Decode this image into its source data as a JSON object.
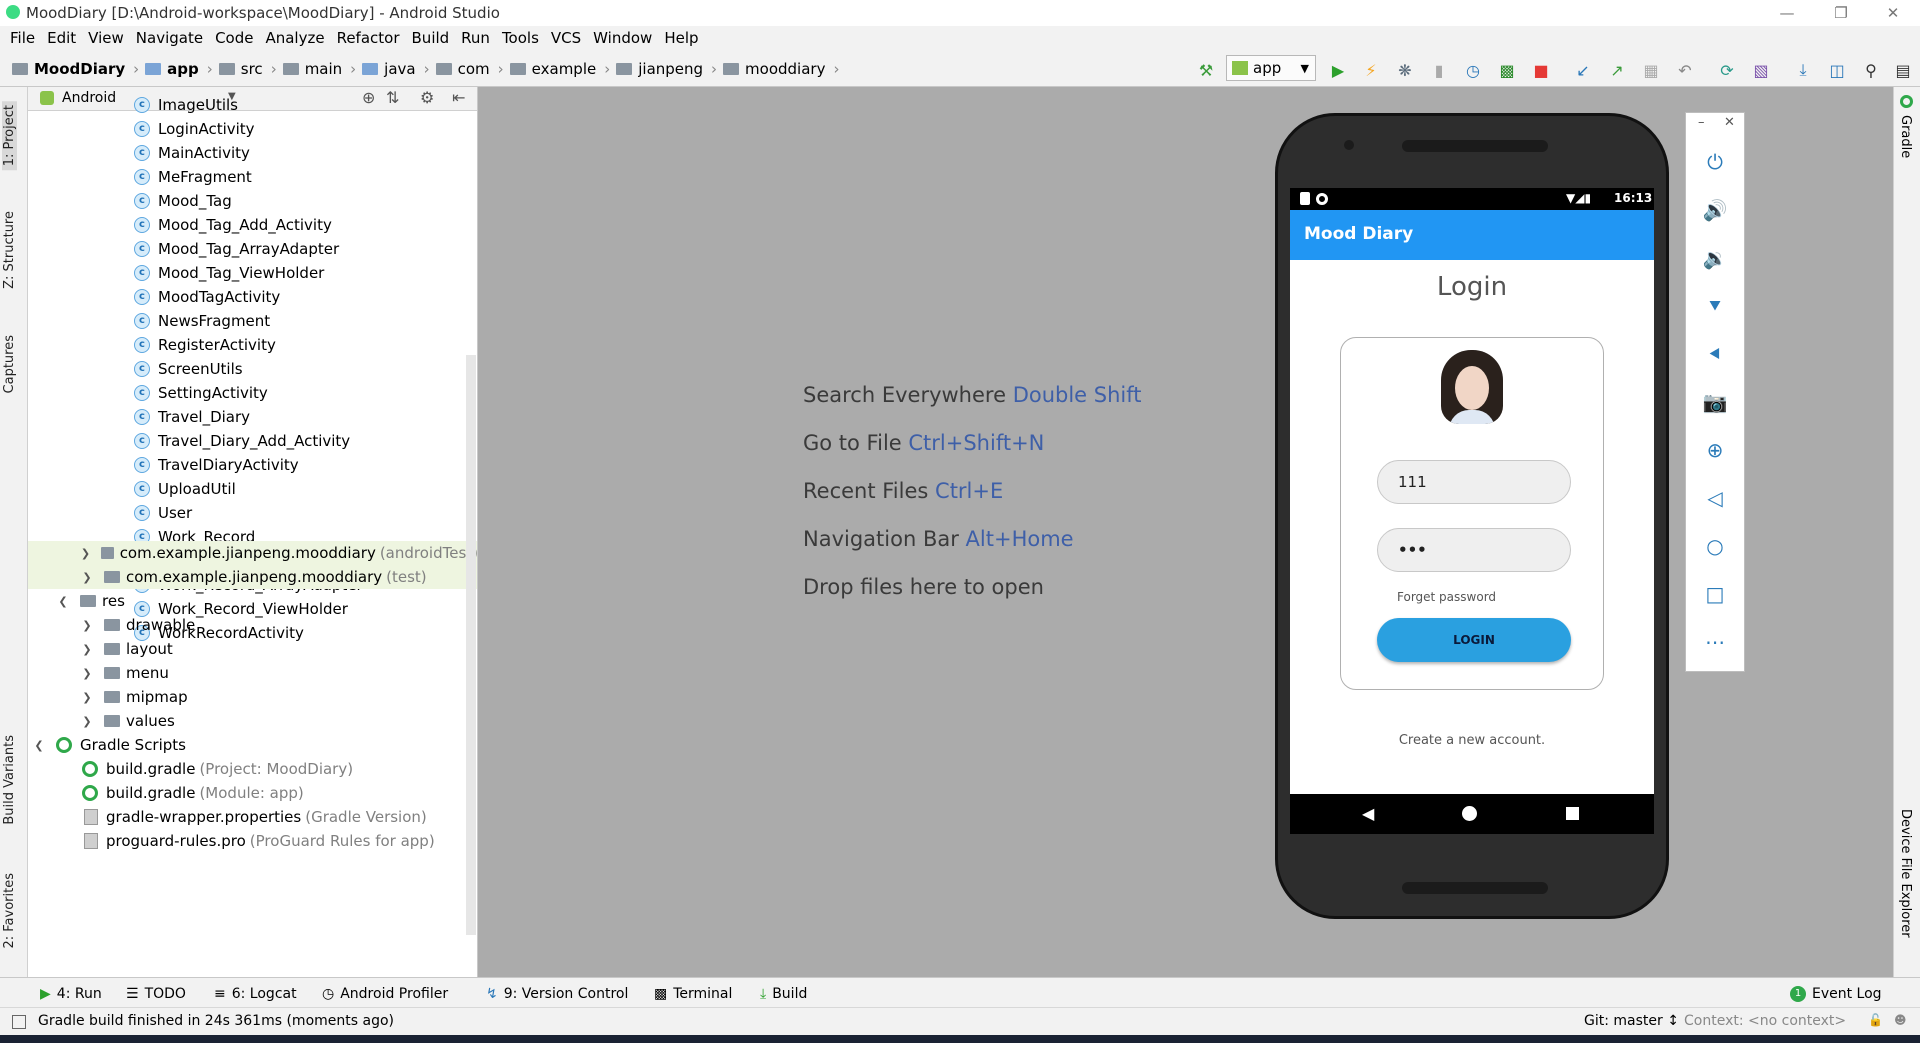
{
  "window": {
    "title": "MoodDiary [D:\\Android-workspace\\MoodDiary] - Android Studio"
  },
  "menu": [
    "File",
    "Edit",
    "View",
    "Navigate",
    "Code",
    "Analyze",
    "Refactor",
    "Build",
    "Run",
    "Tools",
    "VCS",
    "Window",
    "Help"
  ],
  "breadcrumb": [
    "MoodDiary",
    "app",
    "src",
    "main",
    "java",
    "com",
    "example",
    "jianpeng",
    "mooddiary"
  ],
  "run_config": "app",
  "project_panel": {
    "view_mode": "Android",
    "classes": [
      "ImageUtils",
      "LoginActivity",
      "MainActivity",
      "MeFragment",
      "Mood_Tag",
      "Mood_Tag_Add_Activity",
      "Mood_Tag_ArrayAdapter",
      "Mood_Tag_ViewHolder",
      "MoodTagActivity",
      "NewsFragment",
      "RegisterActivity",
      "ScreenUtils",
      "SettingActivity",
      "Travel_Diary",
      "Travel_Diary_Add_Activity",
      "TravelDiaryActivity",
      "UploadUtil",
      "User",
      "Work_Record",
      "Work_Record_Add_Activity",
      "Work_Record_ArrayAdapter",
      "Work_Record_ViewHolder",
      "WorkRecordActivity"
    ],
    "packages": [
      {
        "name": "com.example.jianpeng.mooddiary",
        "suffix": "(androidTest)"
      },
      {
        "name": "com.example.jianpeng.mooddiary",
        "suffix": "(test)"
      }
    ],
    "res_label": "res",
    "res_children": [
      "drawable",
      "layout",
      "menu",
      "mipmap",
      "values"
    ],
    "gradle_label": "Gradle Scripts",
    "gradle_files": [
      {
        "name": "build.gradle",
        "suffix": "(Project: MoodDiary)"
      },
      {
        "name": "build.gradle",
        "suffix": "(Module: app)"
      },
      {
        "name": "gradle-wrapper.properties",
        "suffix": "(Gradle Version)"
      },
      {
        "name": "proguard-rules.pro",
        "suffix": "(ProGuard Rules for app)"
      }
    ]
  },
  "left_tabs": [
    "1: Project",
    "Z: Structure",
    "Captures",
    "Build Variants",
    "2: Favorites"
  ],
  "right_tabs": [
    "Gradle",
    "Device File Explorer"
  ],
  "editor_hints": [
    {
      "text": "Search Everywhere",
      "key": "Double Shift"
    },
    {
      "text": "Go to File",
      "key": "Ctrl+Shift+N"
    },
    {
      "text": "Recent Files",
      "key": "Ctrl+E"
    },
    {
      "text": "Navigation Bar",
      "key": "Alt+Home"
    },
    {
      "text": "Drop files here to open",
      "key": ""
    }
  ],
  "emulator": {
    "status_time": "16:13",
    "app_title": "Mood Diary",
    "screen_title": "Login",
    "username_value": "111",
    "password_value": "•••",
    "forget_label": "Forget password",
    "login_label": "LOGIN",
    "create_account": "Create a new account."
  },
  "bottom_tabs": [
    {
      "label": "4: Run",
      "icon": "run-icon"
    },
    {
      "label": "TODO",
      "icon": "todo-icon"
    },
    {
      "label": "6: Logcat",
      "icon": "logcat-icon"
    },
    {
      "label": "Android Profiler",
      "icon": "profiler-icon"
    },
    {
      "label": "9: Version Control",
      "icon": "vcs-icon"
    },
    {
      "label": "Terminal",
      "icon": "terminal-icon"
    },
    {
      "label": "Build",
      "icon": "build-icon"
    }
  ],
  "event_log": {
    "label": "Event Log",
    "count": "1"
  },
  "status": {
    "message": "Gradle build finished in 24s 361ms (moments ago)",
    "git": "Git: master ↕",
    "context": "Context: <no context>"
  },
  "colors": {
    "accent": "#2196f3",
    "button": "#2aa0e0",
    "hint_key": "#3e5fa8"
  }
}
